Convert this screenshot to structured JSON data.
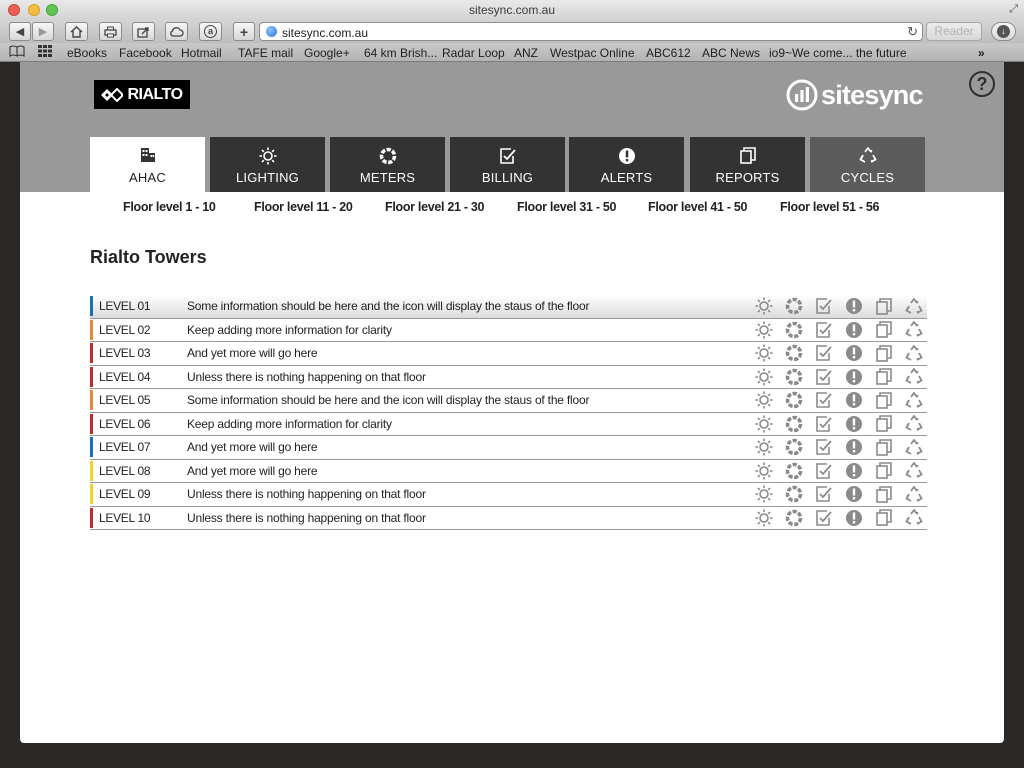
{
  "browser": {
    "window_title": "sitesync.com.au",
    "url": "sitesync.com.au",
    "reader_label": "Reader",
    "bookmarks": [
      "eBooks",
      "Facebook",
      "Hotmail",
      "TAFE mail",
      "Google+",
      "64 km Brish...",
      "Radar Loop",
      "ANZ",
      "Westpac Online",
      "ABC612",
      "ABC News",
      "io9~We come... the future"
    ]
  },
  "header": {
    "brand": "RIALTO",
    "product": "sitesync",
    "help_label": "?"
  },
  "tabs": [
    {
      "label": "AHAC",
      "icon": "building-icon",
      "active": true
    },
    {
      "label": "LIGHTING",
      "icon": "sun-icon"
    },
    {
      "label": "METERS",
      "icon": "meter-ring-icon"
    },
    {
      "label": "BILLING",
      "icon": "check-doc-icon"
    },
    {
      "label": "ALERTS",
      "icon": "alert-icon"
    },
    {
      "label": "REPORTS",
      "icon": "pages-icon"
    },
    {
      "label": "CYCLES",
      "icon": "recycle-icon"
    }
  ],
  "floor_ranges": [
    "Floor level 1  - 10",
    "Floor level 11 - 20",
    "Floor level 21 - 30",
    "Floor level 31 - 50",
    "Floor level 41 - 50",
    "Floor level 51 - 56"
  ],
  "building": {
    "title": "Rialto Towers"
  },
  "levels": [
    {
      "name": "LEVEL 01",
      "info": "Some information should be here and the icon will display the staus of the floor",
      "color": "#1f6fb8"
    },
    {
      "name": "LEVEL 02",
      "info": "Keep adding more information for clarity",
      "color": "#e58a2e"
    },
    {
      "name": "LEVEL 03",
      "info": "And yet more will go here",
      "color": "#c62828"
    },
    {
      "name": "LEVEL 04",
      "info": "Unless there is nothing happening on that floor",
      "color": "#c62828"
    },
    {
      "name": "LEVEL 05",
      "info": "Some information should be here and the icon will display the staus of the floor",
      "color": "#e58a2e"
    },
    {
      "name": "LEVEL 06",
      "info": "Keep adding more information for clarity",
      "color": "#c62828"
    },
    {
      "name": "LEVEL 07",
      "info": "And yet more will go here",
      "color": "#1f6fb8"
    },
    {
      "name": "LEVEL 08",
      "info": "And yet more will go here",
      "color": "#f2d02e"
    },
    {
      "name": "LEVEL 09",
      "info": "Unless there is nothing happening on that floor",
      "color": "#f2d02e"
    },
    {
      "name": "LEVEL 10",
      "info": "Unless there is nothing happening on that floor",
      "color": "#c62828"
    }
  ],
  "status_icons": [
    "sun-icon",
    "meter-ring-icon",
    "check-doc-icon",
    "alert-icon",
    "pages-icon",
    "recycle-icon"
  ]
}
